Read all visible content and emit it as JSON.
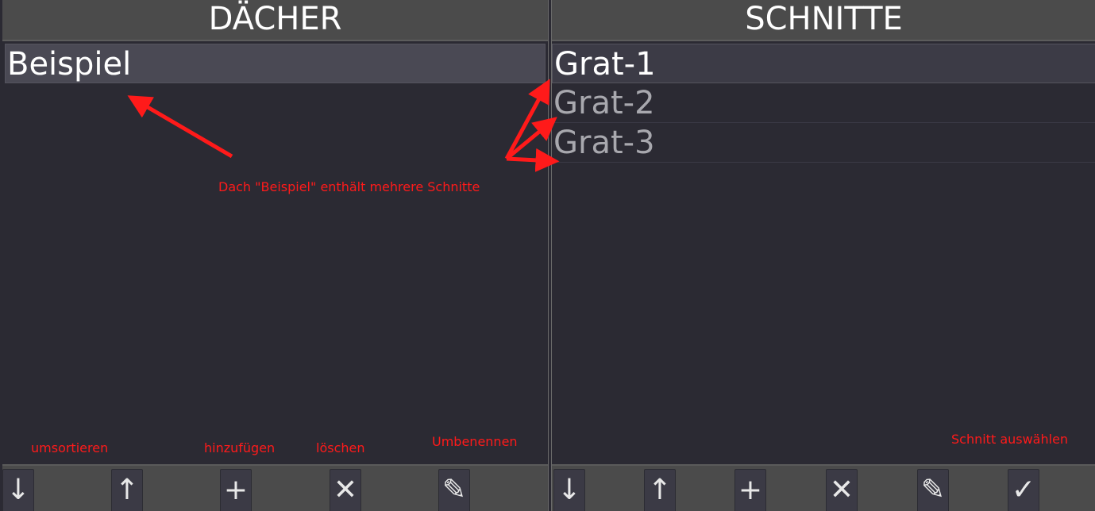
{
  "left_panel": {
    "title": "DÄCHER",
    "items": [
      {
        "label": "Beispiel"
      }
    ],
    "toolbar": [
      {
        "name": "move-down",
        "glyph": "↓"
      },
      {
        "name": "move-up",
        "glyph": "↑"
      },
      {
        "name": "add",
        "glyph": "+"
      },
      {
        "name": "delete",
        "glyph": "✕"
      },
      {
        "name": "rename",
        "glyph": "✎"
      }
    ]
  },
  "right_panel": {
    "title": "SCHNITTE",
    "items": [
      {
        "label": "Grat-1"
      },
      {
        "label": "Grat-2"
      },
      {
        "label": "Grat-3"
      }
    ],
    "toolbar": [
      {
        "name": "move-down",
        "glyph": "↓"
      },
      {
        "name": "move-up",
        "glyph": "↑"
      },
      {
        "name": "add",
        "glyph": "+"
      },
      {
        "name": "delete",
        "glyph": "✕"
      },
      {
        "name": "rename",
        "glyph": "✎"
      },
      {
        "name": "select",
        "glyph": "✓"
      }
    ]
  },
  "annotations": {
    "roof_contains_cuts": "Dach \"Beispiel\" enthält mehrere Schnitte",
    "reorder": "umsortieren",
    "add": "hinzufügen",
    "delete": "löschen",
    "rename": "Umbenennen",
    "select_cut": "Schnitt auswählen",
    "color": "#ff1a1a"
  }
}
